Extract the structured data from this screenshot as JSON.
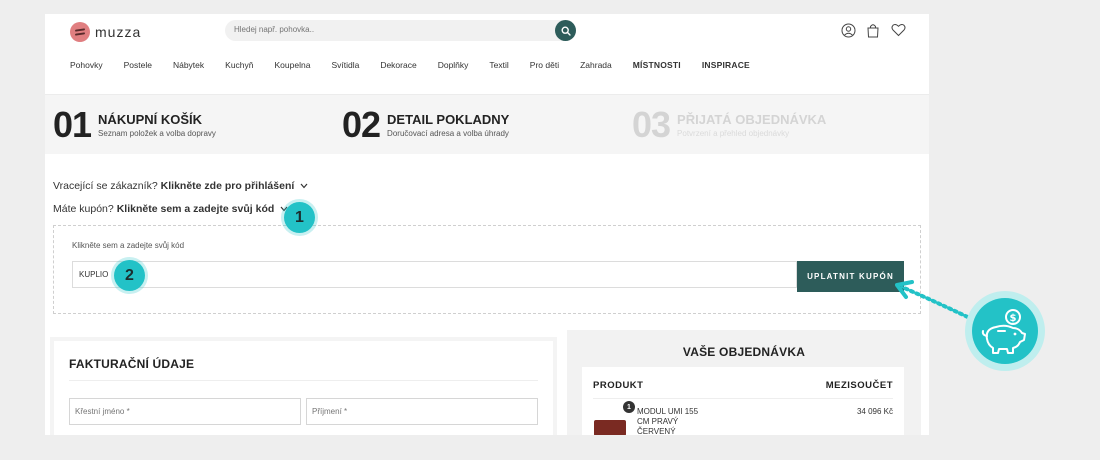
{
  "header": {
    "logo_text": "muzza",
    "search_placeholder": "Hledej např. pohovka.."
  },
  "nav": {
    "items": [
      "Pohovky",
      "Postele",
      "Nábytek",
      "Kuchyň",
      "Koupelna",
      "Svítidla",
      "Dekorace",
      "Doplňky",
      "Textil",
      "Pro děti",
      "Zahrada"
    ],
    "bold_items": [
      "MÍSTNOSTI",
      "INSPIRACE"
    ]
  },
  "steps": [
    {
      "num": "01",
      "title": "NÁKUPNÍ KOŠÍK",
      "sub": "Seznam položek a volba dopravy"
    },
    {
      "num": "02",
      "title": "DETAIL POKLADNY",
      "sub": "Doručovací adresa a volba úhrady"
    },
    {
      "num": "03",
      "title": "PŘIJATÁ OBJEDNÁVKA",
      "sub": "Potvrzení a přehled objednávky"
    }
  ],
  "login_notice": {
    "text": "Vracející se zákazník?",
    "link": "Klikněte zde pro přihlášení"
  },
  "coupon_notice": {
    "text": "Máte kupón?",
    "link": "Klikněte sem a zadejte svůj kód"
  },
  "coupon": {
    "label": "Klikněte sem a zadejte svůj kód",
    "value": "KUPLIO",
    "button": "UPLATNIT KUPÓN"
  },
  "billing": {
    "title": "FAKTURAČNÍ ÚDAJE",
    "first_name_placeholder": "Křestní jméno *",
    "last_name_placeholder": "Příjmení *"
  },
  "order": {
    "title": "VAŠE OBJEDNÁVKA",
    "col_product": "PRODUKT",
    "col_subtotal": "MEZISOUČET",
    "product_qty": "1",
    "product_name": "MODUL UMI 155 CM PRAVÝ ČERVENÝ",
    "product_price": "34 096 Kč"
  },
  "markers": [
    "1",
    "2"
  ],
  "colors": {
    "accent": "#2d5c5a",
    "marker": "#23c2c7",
    "logo": "#e07e80"
  }
}
